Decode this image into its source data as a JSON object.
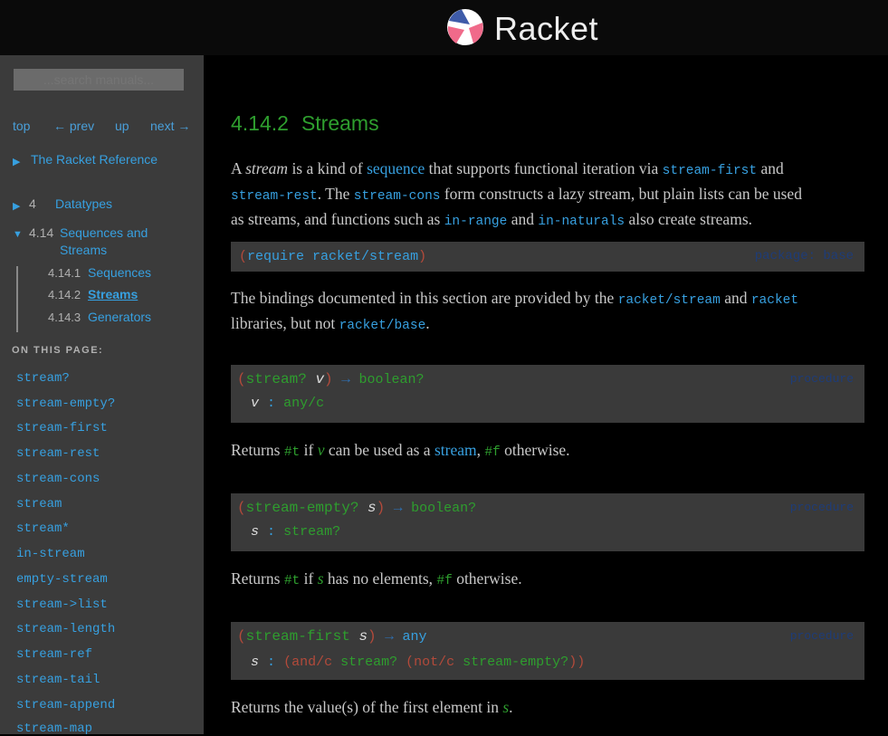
{
  "header": {
    "logo_text": "Racket"
  },
  "sidebar": {
    "search_placeholder": "...search manuals...",
    "nav": {
      "top": "top",
      "prev": "← prev",
      "up": "up",
      "next": "next →"
    },
    "reference": "The Racket Reference",
    "chapter_num": "4",
    "chapter_label": "Datatypes",
    "section_num": "4.14",
    "section_label_1": "Sequences and",
    "section_label_2": "Streams",
    "sub": [
      {
        "num": "4.14.1",
        "label": "Sequences"
      },
      {
        "num": "4.14.2",
        "label": "Streams"
      },
      {
        "num": "4.14.3",
        "label": "Generators"
      }
    ],
    "on_this_page": "ON THIS PAGE:",
    "toc": [
      "stream?",
      "stream-empty?",
      "stream-first",
      "stream-rest",
      "stream-cons",
      "stream",
      "stream*",
      "in-stream",
      "empty-stream",
      "stream->list",
      "stream-length",
      "stream-ref",
      "stream-tail",
      "stream-append",
      "stream-map"
    ]
  },
  "main": {
    "heading_num": "4.14.2",
    "heading_title": "Streams",
    "intro": {
      "a": "A ",
      "stream": "stream",
      "is": " is a kind of ",
      "sequence": "sequence",
      "supports": " that supports functional iteration via ",
      "stream_first": "stream-first",
      "and1": " and",
      "stream_rest": "stream-rest",
      "the": ". The ",
      "stream_cons": "stream-cons",
      "form": " form constructs a lazy stream, but plain lists can be used",
      "as": "as streams, and functions such as ",
      "in_range": "in-range",
      "and2": " and ",
      "in_naturals": "in-naturals",
      "also": " also create streams."
    },
    "require": {
      "open": "(",
      "kw": "require",
      "mod": "racket/stream",
      "close": ")",
      "package": "package: base"
    },
    "bindings": {
      "pre": "The bindings documented in this section are provided by the ",
      "mod1": "racket/stream",
      "and": " and ",
      "mod2": "racket",
      "libs": "libraries, but not ",
      "mod3": "racket/base",
      "dot": "."
    },
    "defs": [
      {
        "name": "stream?",
        "arg": "v",
        "ret": "boolean?",
        "contract": "any/c",
        "kind": "procedure"
      },
      {
        "name": "stream-empty?",
        "arg": "s",
        "ret": "boolean?",
        "contract": "stream?",
        "kind": "procedure"
      },
      {
        "name": "stream-first",
        "arg": "s",
        "ret": "any",
        "kind": "procedure"
      }
    ],
    "def3_contract": {
      "and": "(and/c",
      "stream": "stream?",
      "not": "(not/c",
      "empty": "stream-empty?",
      "close": "))"
    },
    "desc1": {
      "returns": "Returns ",
      "t": "#t",
      "if": " if ",
      "v": "v",
      "can": " can be used as a ",
      "stream": "stream",
      "comma": ", ",
      "f": "#f",
      "other": " otherwise."
    },
    "desc2": {
      "returns": "Returns ",
      "t": "#t",
      "if": " if ",
      "s": "s",
      "has": " has no elements, ",
      "f": "#f",
      "other": " otherwise."
    },
    "desc3": {
      "returns": "Returns the value(s) of the first element in ",
      "s": "s",
      "dot": "."
    },
    "colors": {
      "green": "#2e9e2e",
      "blue": "#37a0e0",
      "sidebar_bg": "#3b3b3b",
      "box_bg": "#3a3a3a"
    }
  }
}
